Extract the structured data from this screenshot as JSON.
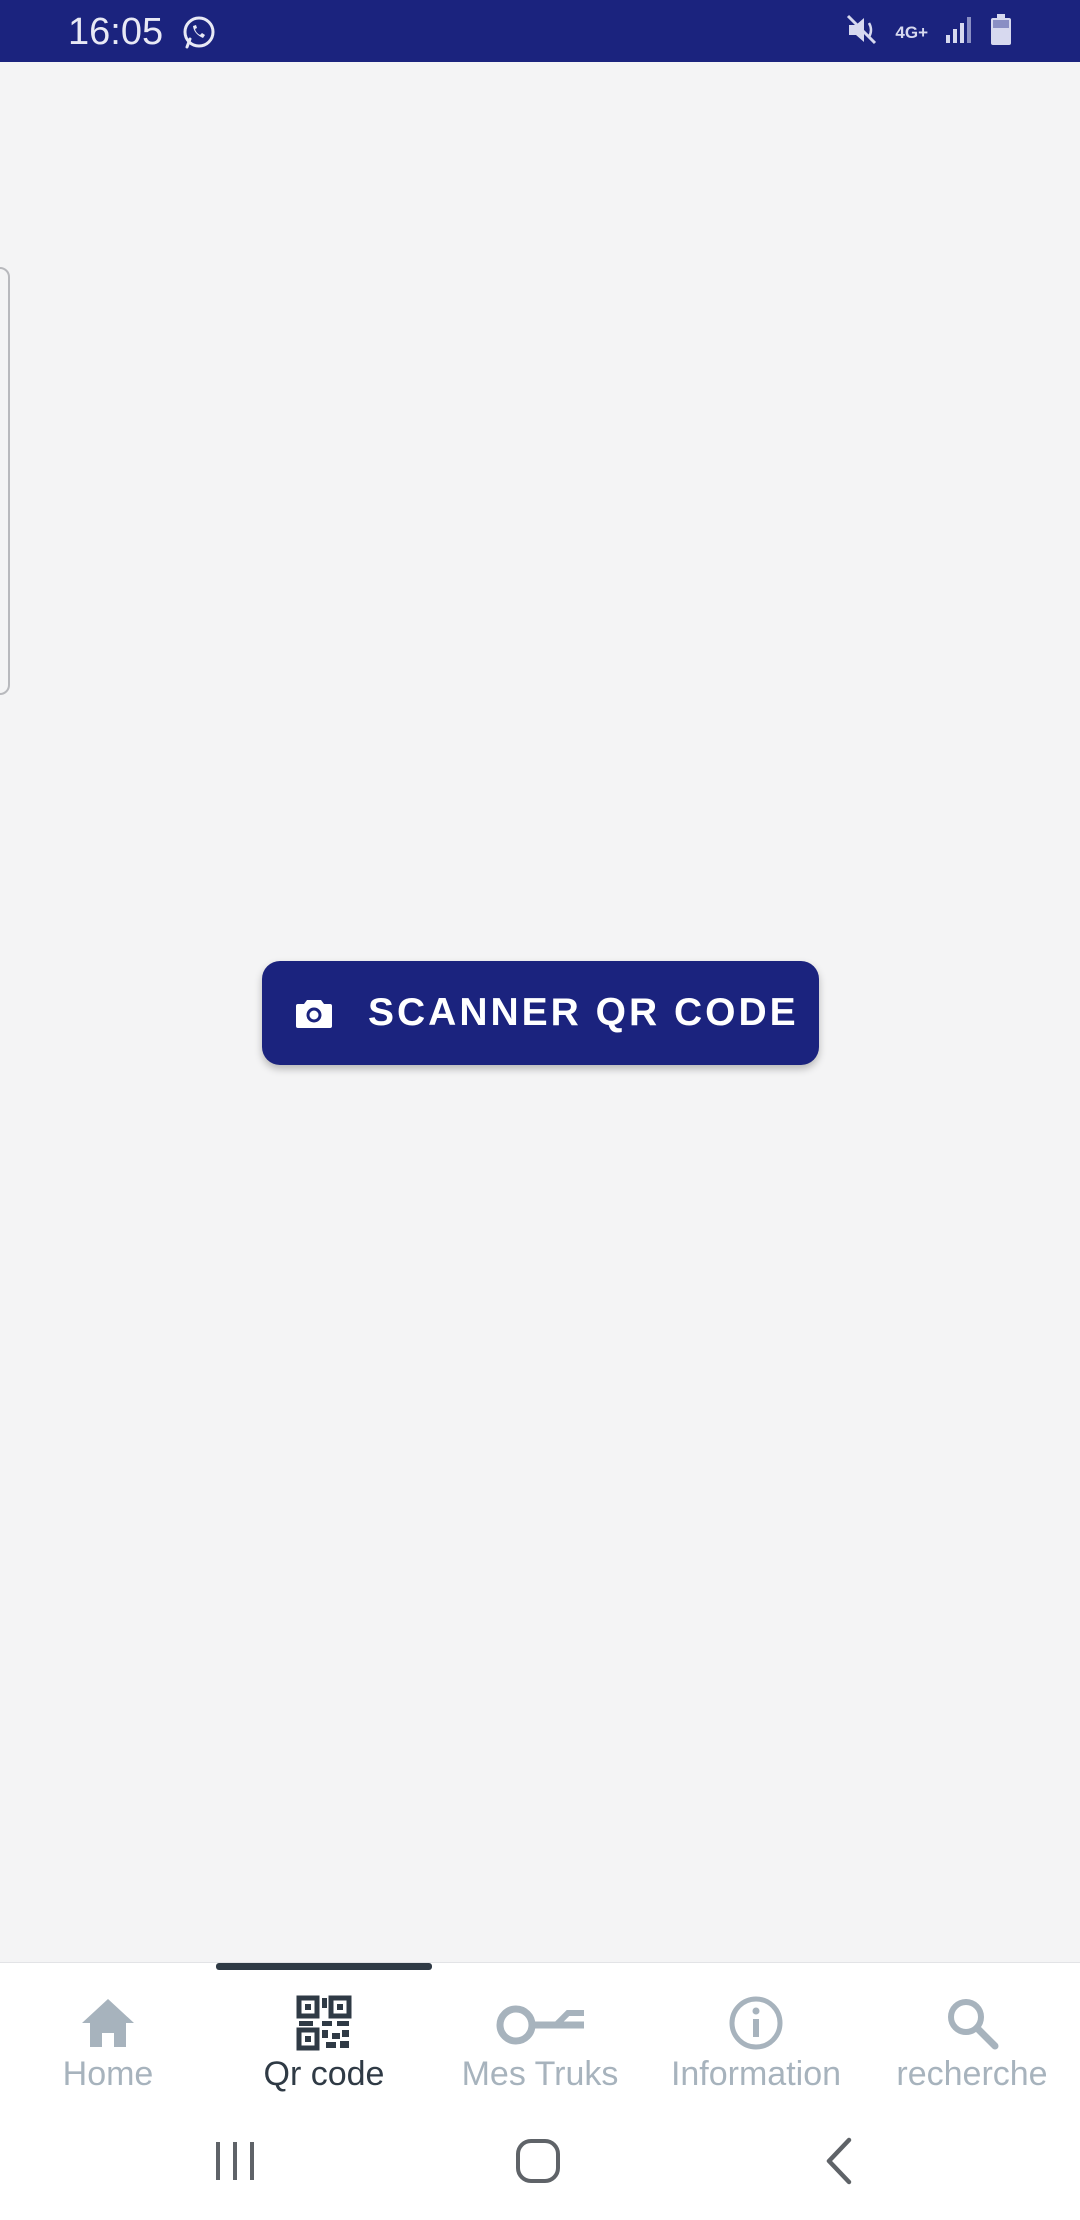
{
  "status_bar": {
    "time": "16:05",
    "network": "4G+",
    "icons": [
      "whatsapp-icon",
      "mute-icon",
      "signal-icon",
      "battery-icon"
    ],
    "background": "#1b237e"
  },
  "main": {
    "scan_button": {
      "label": "SCANNER QR CODE",
      "icon": "camera-icon",
      "color": "#1b237e"
    }
  },
  "bottom_nav": {
    "active_index": 1,
    "items": [
      {
        "label": "Home",
        "icon": "home-icon"
      },
      {
        "label": "Qr code",
        "icon": "qr-code-icon"
      },
      {
        "label": "Mes Truks",
        "icon": "key-icon"
      },
      {
        "label": "Information",
        "icon": "info-icon"
      },
      {
        "label": "recherche",
        "icon": "search-icon"
      }
    ],
    "active_color": "#2f3a45",
    "inactive_color": "#a7b3bd"
  },
  "system_nav": {
    "buttons": [
      "recent-apps-icon",
      "home-circle-icon",
      "back-icon"
    ]
  }
}
